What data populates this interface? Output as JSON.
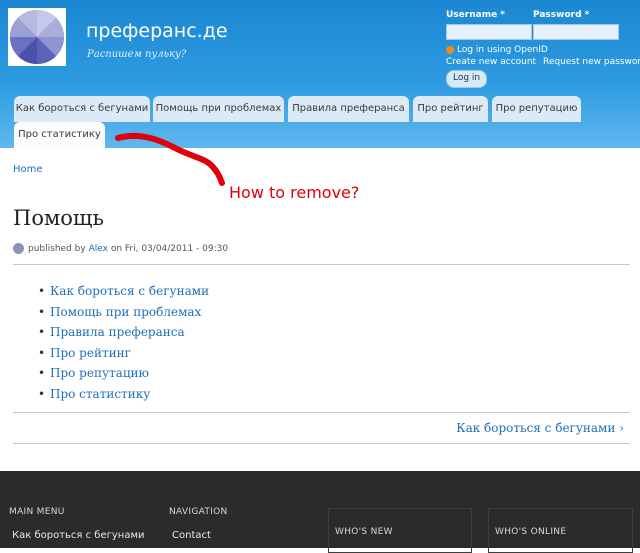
{
  "header": {
    "site_name": "преферанс.де",
    "site_slogan": "Распишем пульку?",
    "login": {
      "username_label": "Username *",
      "password_label": "Password *",
      "openid_link": "Log in using OpenID",
      "create_account": "Create new account",
      "request_password": "Request new password",
      "login_button": "Log in"
    }
  },
  "tabs": [
    {
      "label": "Как бороться с бегунами"
    },
    {
      "label": "Помощь при проблемах"
    },
    {
      "label": "Правила преферанса"
    },
    {
      "label": "Про рейтинг"
    },
    {
      "label": "Про репутацию"
    },
    {
      "label": "Про статистику"
    }
  ],
  "annotation": {
    "text": "How to remove?",
    "color": "#e0000a"
  },
  "breadcrumb": {
    "home": "Home"
  },
  "page": {
    "title": "Помощь",
    "submitted_prefix": "published by",
    "author": "Alex",
    "submitted_suffix": "on Fri, 03/04/2011 - 09:30"
  },
  "book_links": [
    "Как бороться с бегунами",
    "Помощь при проблемах",
    "Правила преферанса",
    "Про рейтинг",
    "Про репутацию",
    "Про статистику"
  ],
  "book_navigation": {
    "next": "Как бороться с бегунами ›"
  },
  "footer": {
    "main_menu_title": "MAIN MENU",
    "main_menu_link": "Как бороться с бегунами",
    "navigation_title": "NAVIGATION",
    "navigation_link": "Contact",
    "whos_new_title": "WHO'S NEW",
    "whos_online_title": "WHO'S ONLINE"
  },
  "colors": {
    "header_blue": "#1c87d2",
    "tab_bg": "#dbeaf5",
    "link": "#1d6fb8",
    "footer_bg": "#2b2b2b"
  }
}
